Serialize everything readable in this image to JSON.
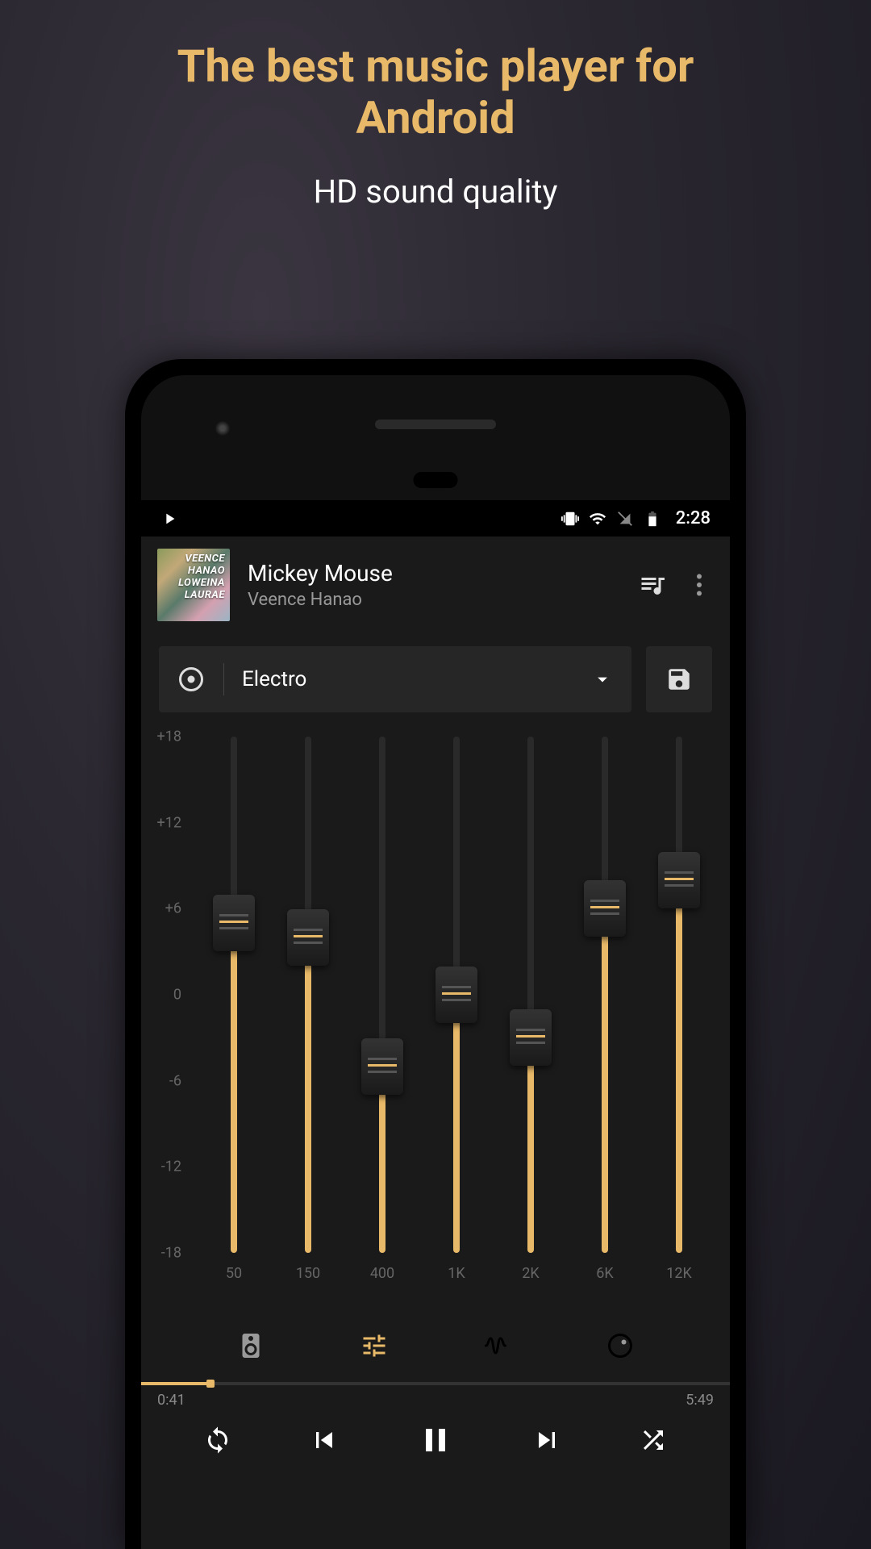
{
  "promo": {
    "title_line1": "The best music player for",
    "title_line2": "Android",
    "subtitle": "HD sound quality"
  },
  "statusbar": {
    "time": "2:28"
  },
  "now_playing": {
    "title": "Mickey Mouse",
    "artist": "Veence Hanao",
    "album_art_text": "VEENCE HANAO LOWEINA LAURAE"
  },
  "preset": {
    "selected": "Electro"
  },
  "equalizer": {
    "y_labels": [
      "+18",
      "+12",
      "+6",
      "0",
      "-6",
      "-12",
      "-18"
    ],
    "bands": [
      {
        "freq": "50",
        "value": 5
      },
      {
        "freq": "150",
        "value": 4
      },
      {
        "freq": "400",
        "value": -5
      },
      {
        "freq": "1K",
        "value": 0
      },
      {
        "freq": "2K",
        "value": -3
      },
      {
        "freq": "6K",
        "value": 6
      },
      {
        "freq": "12K",
        "value": 8
      }
    ],
    "min": -18,
    "max": 18
  },
  "playback": {
    "elapsed": "0:41",
    "duration": "5:49",
    "elapsed_sec": 41,
    "duration_sec": 349
  }
}
